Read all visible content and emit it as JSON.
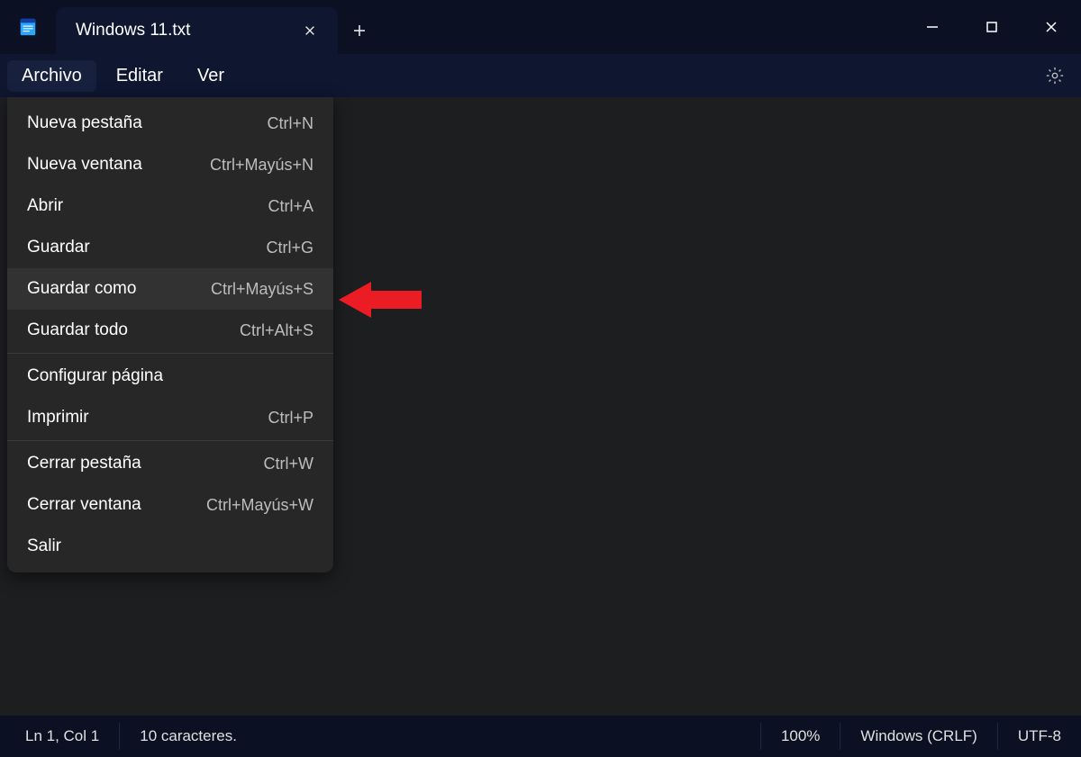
{
  "tab": {
    "title": "Windows 11.txt"
  },
  "menubar": {
    "file": "Archivo",
    "edit": "Editar",
    "view": "Ver"
  },
  "file_menu": {
    "new_tab": {
      "label": "Nueva pestaña",
      "shortcut": "Ctrl+N"
    },
    "new_window": {
      "label": "Nueva ventana",
      "shortcut": "Ctrl+Mayús+N"
    },
    "open": {
      "label": "Abrir",
      "shortcut": "Ctrl+A"
    },
    "save": {
      "label": "Guardar",
      "shortcut": "Ctrl+G"
    },
    "save_as": {
      "label": "Guardar como",
      "shortcut": "Ctrl+Mayús+S"
    },
    "save_all": {
      "label": "Guardar todo",
      "shortcut": "Ctrl+Alt+S"
    },
    "page_setup": {
      "label": "Configurar página",
      "shortcut": ""
    },
    "print": {
      "label": "Imprimir",
      "shortcut": "Ctrl+P"
    },
    "close_tab": {
      "label": "Cerrar pestaña",
      "shortcut": "Ctrl+W"
    },
    "close_window": {
      "label": "Cerrar ventana",
      "shortcut": "Ctrl+Mayús+W"
    },
    "exit": {
      "label": "Salir",
      "shortcut": ""
    }
  },
  "statusbar": {
    "position": "Ln 1, Col 1",
    "chars": "10 caracteres.",
    "zoom": "100%",
    "line_ending": "Windows (CRLF)",
    "encoding": "UTF-8"
  }
}
